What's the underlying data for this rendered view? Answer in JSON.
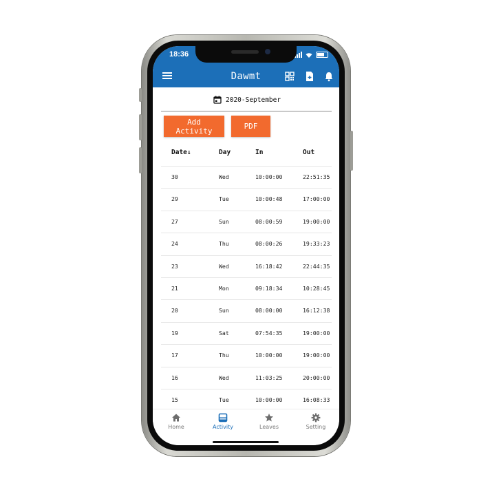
{
  "status_bar": {
    "time": "18:36"
  },
  "app_bar": {
    "title": "Dawmt"
  },
  "month_picker": {
    "label": "2020-September"
  },
  "actions": {
    "add_activity": "Add Activity",
    "pdf": "PDF"
  },
  "table": {
    "headers": {
      "date": "Date",
      "sort_indicator": "↓",
      "day": "Day",
      "in": "In",
      "out": "Out"
    },
    "rows": [
      {
        "date": "30",
        "day": "Wed",
        "in": "10:00:00",
        "out": "22:51:35"
      },
      {
        "date": "29",
        "day": "Tue",
        "in": "10:00:48",
        "out": "17:00:00"
      },
      {
        "date": "27",
        "day": "Sun",
        "in": "08:00:59",
        "out": "19:00:00"
      },
      {
        "date": "24",
        "day": "Thu",
        "in": "08:00:26",
        "out": "19:33:23"
      },
      {
        "date": "23",
        "day": "Wed",
        "in": "16:18:42",
        "out": "22:44:35"
      },
      {
        "date": "21",
        "day": "Mon",
        "in": "09:18:34",
        "out": "10:28:45"
      },
      {
        "date": "20",
        "day": "Sun",
        "in": "08:00:00",
        "out": "16:12:38"
      },
      {
        "date": "19",
        "day": "Sat",
        "in": "07:54:35",
        "out": "19:00:00"
      },
      {
        "date": "17",
        "day": "Thu",
        "in": "10:00:00",
        "out": "19:00:00"
      },
      {
        "date": "16",
        "day": "Wed",
        "in": "11:03:25",
        "out": "20:00:00"
      },
      {
        "date": "15",
        "day": "Tue",
        "in": "10:00:00",
        "out": "16:08:33"
      }
    ]
  },
  "bottom_nav": {
    "items": [
      {
        "label": "Home",
        "icon": "home-icon"
      },
      {
        "label": "Activity",
        "icon": "activity-icon"
      },
      {
        "label": "Leaves",
        "icon": "star-icon"
      },
      {
        "label": "Setting",
        "icon": "gear-icon"
      }
    ],
    "active": "Activity"
  },
  "colors": {
    "primary": "#1c6fb8",
    "accent": "#f26a2e"
  }
}
